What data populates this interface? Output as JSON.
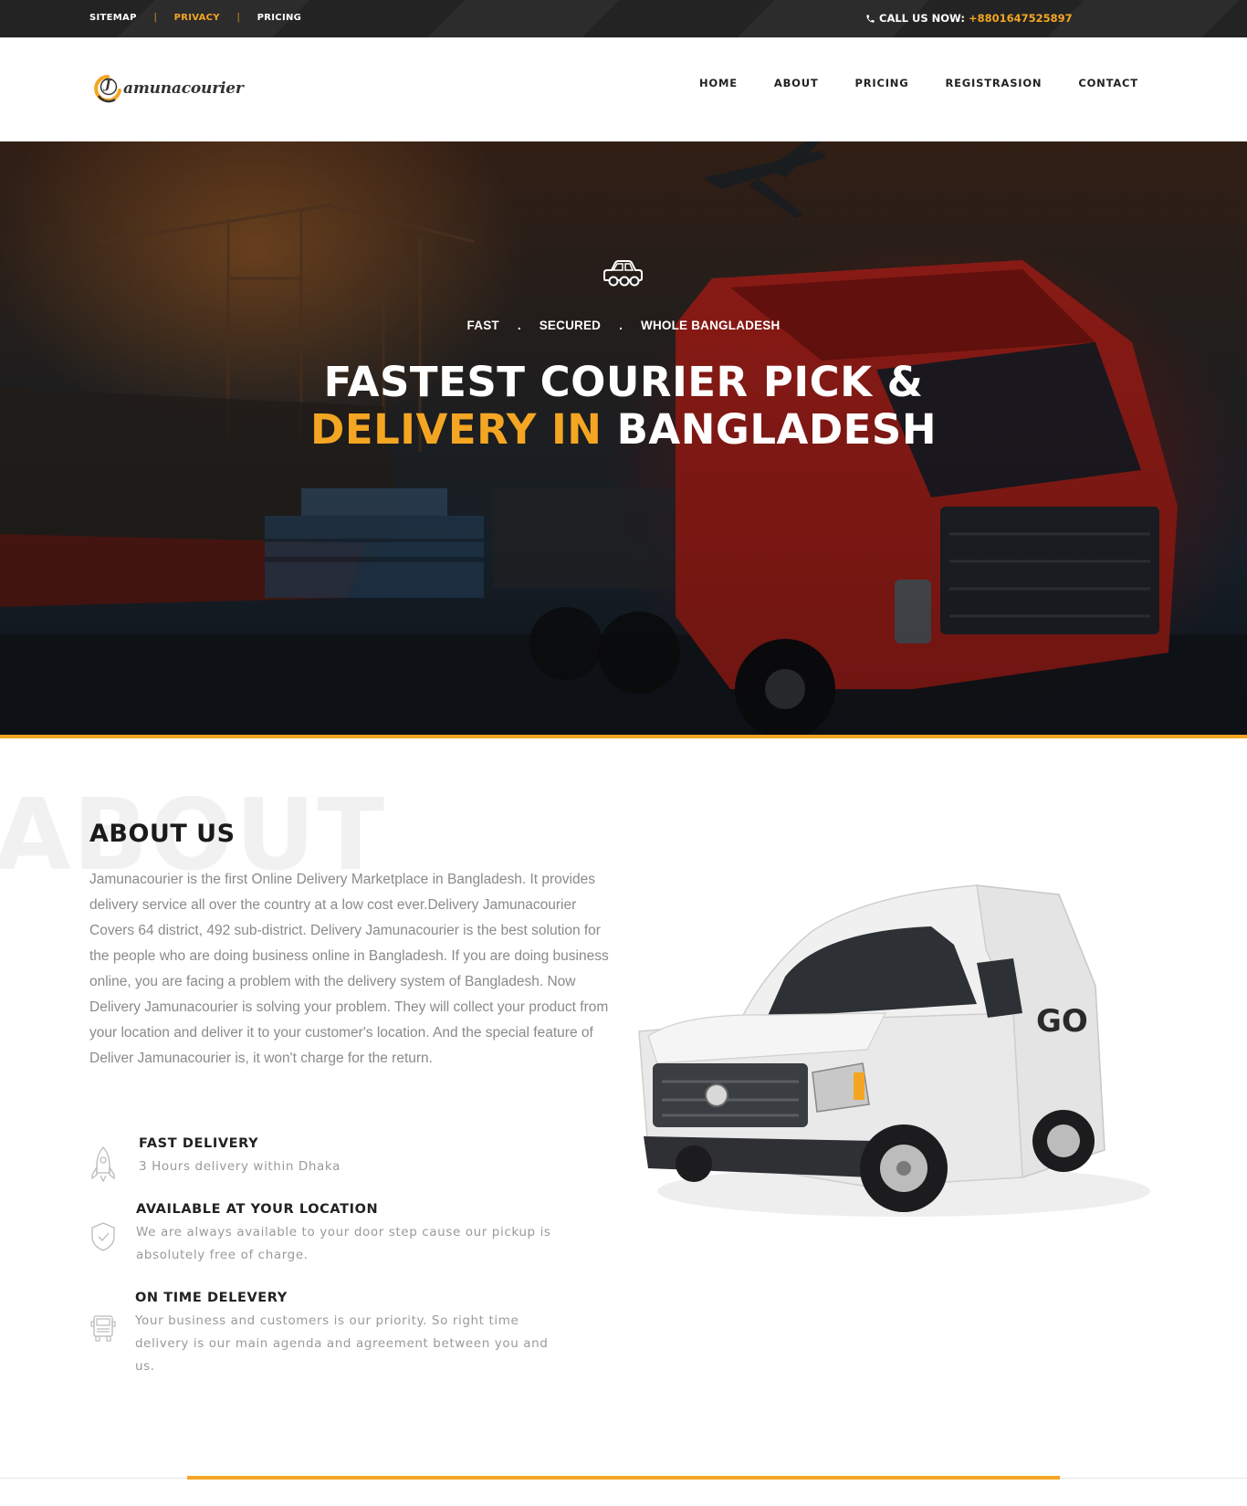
{
  "topbar": {
    "links": [
      {
        "label": "SITEMAP"
      },
      {
        "label": "PRIVACY"
      },
      {
        "label": "PRICING"
      }
    ],
    "separator": "|",
    "call_label": "CALL US NOW:",
    "phone": "+8801647525897"
  },
  "header": {
    "logo_letter": "J",
    "logo_text": "amunacourier",
    "nav": [
      "HOME",
      "ABOUT",
      "PRICING",
      "REGISTRASION",
      "CONTACT"
    ]
  },
  "hero": {
    "icon": "car-icon",
    "tags": [
      "FAST",
      "SECURED",
      "WHOLE BANGLADESH"
    ],
    "tag_separator": ".",
    "title_line1": "FASTEST COURIER PICK &",
    "title_line2_accent": "DELIVERY IN",
    "title_line2_rest": "BANGLADESH"
  },
  "about": {
    "bg_word": "ABOUT",
    "title": "ABOUT US",
    "text": "Jamunacourier is the first Online Delivery Marketplace in Bangladesh. It provides delivery service all over the country at a low cost ever.Delivery Jamunacourier Covers 64 district, 492 sub-district. Delivery Jamunacourier is the best solution for the people who are doing business online in Bangladesh. If you are doing business online, you are facing a problem with the delivery system of Bangladesh. Now Delivery Jamunacourier is solving your problem. They will collect your product from your location and deliver it to your customer's location. And the special feature of Deliver Jamunacourier is, it won't charge for the return.",
    "features": [
      {
        "icon": "rocket-icon",
        "title": "FAST DELIVERY",
        "desc": "3 Hours delivery within Dhaka"
      },
      {
        "icon": "shield-icon",
        "title": "AVAILABLE AT YOUR LOCATION",
        "desc": "We are always available to your door step cause our pickup is absolutely free of charge."
      },
      {
        "icon": "truck-icon",
        "title": "ON TIME DELEVERY",
        "desc": "Your business and customers is our priority. So right time delivery is our main agenda and agreement between you and us."
      }
    ],
    "van_badge": "GO"
  },
  "colors": {
    "accent": "#f4a623",
    "topbar_bg": "#232323",
    "text_dark": "#222222",
    "text_muted": "#8a8a8a"
  }
}
